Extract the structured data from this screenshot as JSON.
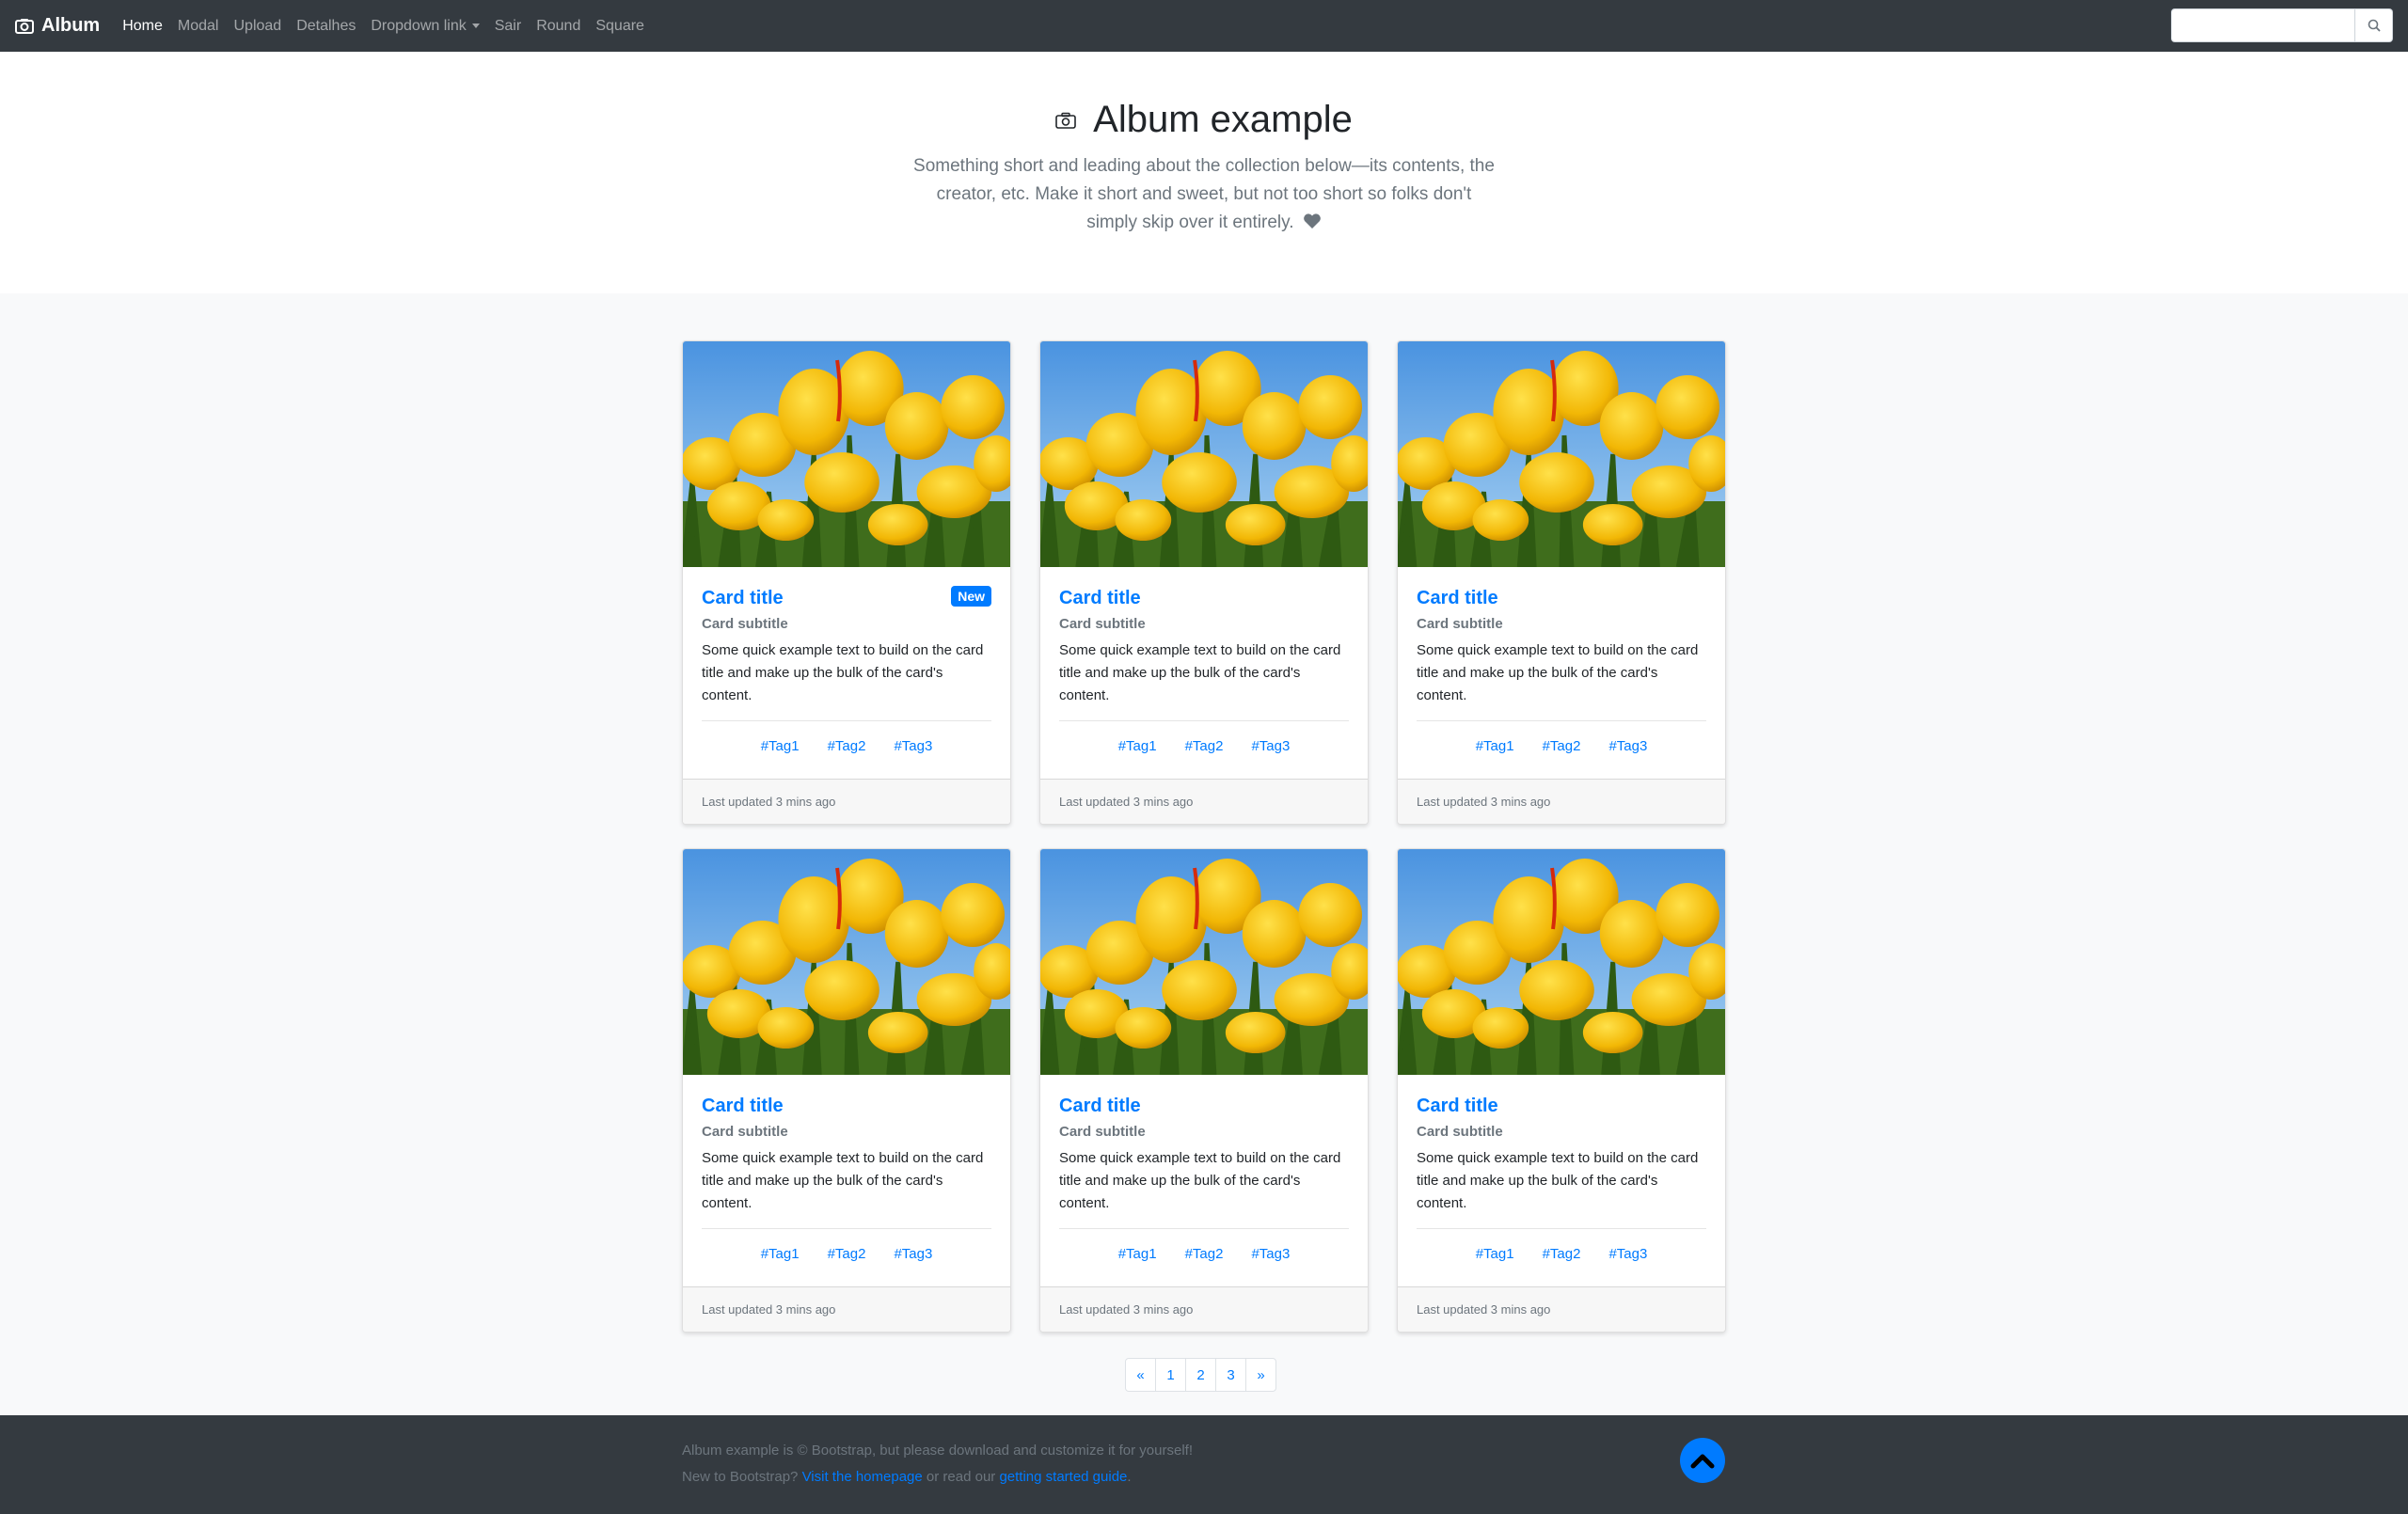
{
  "navbar": {
    "brand": "Album",
    "brand_icon": "camera-icon",
    "links": [
      {
        "label": "Home",
        "active": true
      },
      {
        "label": "Modal"
      },
      {
        "label": "Upload"
      },
      {
        "label": "Detalhes"
      },
      {
        "label": "Dropdown link",
        "dropdown": true
      },
      {
        "label": "Sair"
      },
      {
        "label": "Round"
      },
      {
        "label": "Square"
      }
    ],
    "search": {
      "placeholder": "",
      "icon": "search-icon"
    }
  },
  "jumbotron": {
    "title": "Album example",
    "title_icon": "camera-icon",
    "lead": "Something short and leading about the collection below—its contents, the creator, etc. Make it short and sweet, but not too short so folks don't simply skip over it entirely.",
    "lead_icon": "heart-icon"
  },
  "cards": [
    {
      "title": "Card title",
      "badge": "New",
      "subtitle": "Card subtitle",
      "text": "Some quick example text to build on the card title and make up the bulk of the card's content.",
      "tags": [
        "#Tag1",
        "#Tag2",
        "#Tag3"
      ],
      "footer": "Last updated 3 mins ago"
    },
    {
      "title": "Card title",
      "subtitle": "Card subtitle",
      "text": "Some quick example text to build on the card title and make up the bulk of the card's content.",
      "tags": [
        "#Tag1",
        "#Tag2",
        "#Tag3"
      ],
      "footer": "Last updated 3 mins ago"
    },
    {
      "title": "Card title",
      "subtitle": "Card subtitle",
      "text": "Some quick example text to build on the card title and make up the bulk of the card's content.",
      "tags": [
        "#Tag1",
        "#Tag2",
        "#Tag3"
      ],
      "footer": "Last updated 3 mins ago"
    },
    {
      "title": "Card title",
      "subtitle": "Card subtitle",
      "text": "Some quick example text to build on the card title and make up the bulk of the card's content.",
      "tags": [
        "#Tag1",
        "#Tag2",
        "#Tag3"
      ],
      "footer": "Last updated 3 mins ago"
    },
    {
      "title": "Card title",
      "subtitle": "Card subtitle",
      "text": "Some quick example text to build on the card title and make up the bulk of the card's content.",
      "tags": [
        "#Tag1",
        "#Tag2",
        "#Tag3"
      ],
      "footer": "Last updated 3 mins ago"
    },
    {
      "title": "Card title",
      "subtitle": "Card subtitle",
      "text": "Some quick example text to build on the card title and make up the bulk of the card's content.",
      "tags": [
        "#Tag1",
        "#Tag2",
        "#Tag3"
      ],
      "footer": "Last updated 3 mins ago"
    }
  ],
  "pagination": [
    "«",
    "1",
    "2",
    "3",
    "»"
  ],
  "footer": {
    "line1": "Album example is © Bootstrap, but please download and customize it for yourself!",
    "line2_prefix": "New to Bootstrap? ",
    "homepage_link": "Visit the homepage",
    "line2_middle": " or read our ",
    "guide_link": "getting started guide",
    "line2_suffix": ".",
    "to_top_icon": "chevron-up-icon"
  },
  "colors": {
    "navbar": "#343a40",
    "primary": "#007bff",
    "muted": "#6c757d"
  }
}
